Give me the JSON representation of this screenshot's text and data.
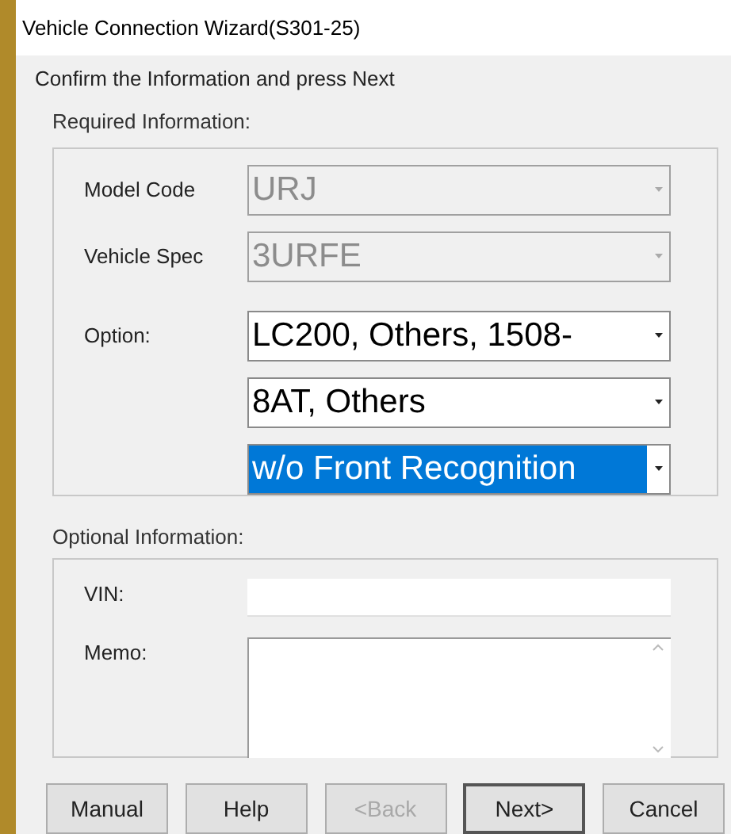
{
  "window": {
    "title": "Vehicle Connection Wizard(S301-25)"
  },
  "instruction": "Confirm the Information and press Next",
  "required": {
    "label": "Required Information:",
    "rows": [
      {
        "label": "Model Code",
        "combos": [
          {
            "value": "URJ",
            "disabled": true,
            "selected": false
          }
        ]
      },
      {
        "label": "Vehicle Spec",
        "combos": [
          {
            "value": "3URFE",
            "disabled": true,
            "selected": false
          }
        ]
      },
      {
        "label": "Option:",
        "combos": [
          {
            "value": "LC200, Others, 1508-",
            "disabled": false,
            "selected": false
          },
          {
            "value": "8AT, Others",
            "disabled": false,
            "selected": false
          },
          {
            "value": "w/o Front Recognition",
            "disabled": false,
            "selected": true
          }
        ]
      }
    ]
  },
  "optional": {
    "label": "Optional Information:",
    "vin": {
      "label": "VIN:"
    },
    "memo": {
      "label": "Memo:"
    }
  },
  "buttons": [
    {
      "label": "Manual",
      "disabled": false,
      "default": false
    },
    {
      "label": "Help",
      "disabled": false,
      "default": false
    },
    {
      "label": "<Back",
      "disabled": true,
      "default": false
    },
    {
      "label": "Next>",
      "disabled": false,
      "default": true
    },
    {
      "label": "Cancel",
      "disabled": false,
      "default": false
    }
  ]
}
